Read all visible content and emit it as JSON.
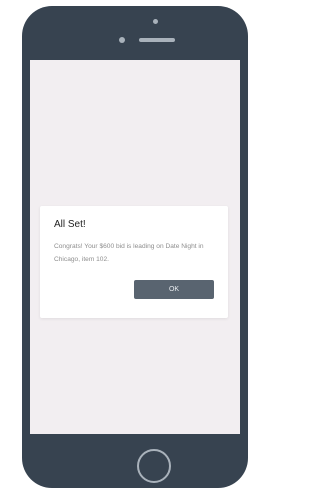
{
  "dialog": {
    "title": "All Set!",
    "message": "Congrats! Your $600 bid is leading on Date Night in Chicago, item 102.",
    "ok_label": "OK"
  },
  "colors": {
    "device_body": "#374350",
    "screen_background": "#f2eef1",
    "dialog_background": "#ffffff",
    "button_background": "#596470"
  }
}
